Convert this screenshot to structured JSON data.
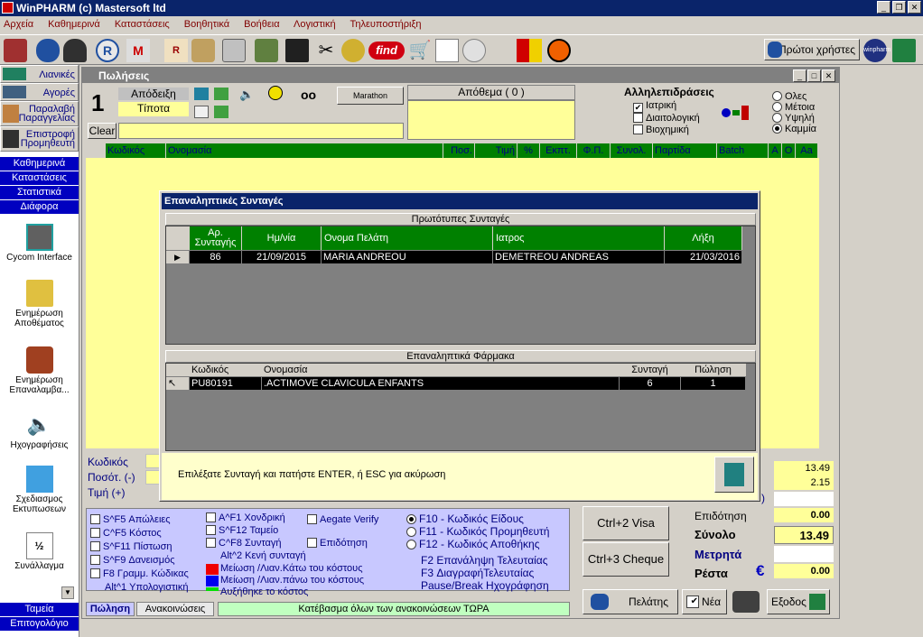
{
  "app": {
    "title": "WinPHARM (c) Mastersoft ltd"
  },
  "menu": [
    "Αρχεία",
    "Καθημερινά",
    "Καταστάσεις",
    "Βοηθητικά",
    "Βοήθεια",
    "Λογιστική",
    "Τηλευποστήριξη"
  ],
  "toolbar": {
    "find_label": "find",
    "first_users": "Πρώτοι χρήστες",
    "winpharm_badge": "winpharm"
  },
  "sidebar": {
    "buttons": [
      "Λιανικές",
      "Αγορές",
      "Παραλαβή Παραγγελίας",
      "Επιστροφή Προμηθευτή"
    ],
    "sections": [
      "Καθημερινά",
      "Καταστάσεις",
      "Στατιστικά",
      "Διάφορα"
    ],
    "icons": [
      "Cycom Interface",
      "Ενημέρωση Αποθέματος",
      "Ενημέρωση Επαναλαμβα...",
      "Ηχογραφήσεις",
      "Σχεδιασμος Εκτυπωσεων",
      "Συνάλλαγμα"
    ],
    "bottom": [
      "Ταμεία",
      "Επιτογολόγιο"
    ]
  },
  "sales": {
    "title": "Πωλήσεις",
    "number": "1",
    "receipt": "Απόδειξη",
    "nothing": "Τίποτα",
    "marathon": "Marathon",
    "stock": "Απόθεμα ( 0 )",
    "clear": "Clear",
    "interactions_title": "Αλληλεπιδράσεις",
    "interactions": [
      {
        "label": "Ιατρική",
        "checked": true
      },
      {
        "label": "Διαιτολογική",
        "checked": false
      },
      {
        "label": "Βιοχημική",
        "checked": false
      }
    ],
    "levels": [
      {
        "label": "Ολες",
        "on": false
      },
      {
        "label": "Μέτοια",
        "on": false
      },
      {
        "label": "Υψηλή",
        "on": false
      },
      {
        "label": "Καμμία",
        "on": true
      }
    ],
    "columns": [
      "Κωδικός",
      "Ονομασία",
      "Ποσ.",
      "Τιμή",
      "%",
      "Εκπτ.",
      "Φ.Π.",
      "Συνολ.",
      "Παρτίδα",
      "Batch",
      "A",
      "O",
      "Aa"
    ]
  },
  "dialog": {
    "title": "Επαναληπτικές Συνταγές",
    "orig_header": "Πρωτότυπες Συνταγές",
    "orig_columns": [
      "Αρ. Συνταγής",
      "Ημ/νία",
      "Ονομα Πελάτη",
      "Ιατρος",
      "Λήξη"
    ],
    "orig_row": [
      "86",
      "21/09/2015",
      "MARIA ANDREOU",
      "DEMETREOU ANDREAS",
      "21/03/2016"
    ],
    "drugs_header": "Επαναληπτικά Φάρμακα",
    "drug_columns": [
      "Κωδικός",
      "Ονομασία",
      "Συνταγή",
      "Πώληση"
    ],
    "drug_row": [
      "PU80191",
      ".ACTIMOVE CLAVICULA ENFANTS",
      "6",
      "1"
    ],
    "hint": "Επιλέξατε Συνταγή και πατήστε ENTER, ή ESC για ακύρωση"
  },
  "entry": {
    "code": "Κωδικός",
    "qty": "Ποσότ. (-)",
    "price": "Τιμή (+)"
  },
  "totals": {
    "v1": "13.49",
    "v2": "2.15",
    "paren": ")",
    "discount_label": "Επιδότηση",
    "discount": "0.00",
    "total_label": "Σύνολο",
    "total": "13.49",
    "cash_label": "Μετρητά",
    "change_label": "Ρέστα",
    "currency": "€",
    "change": "0.00"
  },
  "shortcuts": {
    "col1": [
      "S^F5 Απώλειες",
      "C^F5 Κόστος",
      "S^F11 Πίστωση",
      "S^F9 Δανεισμός",
      "F8 Γραμμ. Κώδικας",
      "Alt^1 Υπολογιστική"
    ],
    "col2": [
      "A^F1 Χονδρική",
      "S^F12 Ταμείο",
      "C^F8 Συνταγή",
      "Alt^2 Κενή συνταγή"
    ],
    "col3": [
      "Aegate Verify",
      "Επιδότηση"
    ],
    "colors": [
      "Μείωση /Λιαν.Κάτω του κόστους",
      "Μείωση /Λιαν.πάνω του κόστους",
      "Αυξήθηκε το κόστος"
    ],
    "radios": [
      "F10 - Κωδικός Είδους",
      "F11 - Κωδικός Προμηθευτή",
      "F12 - Κωδικός Αποθήκης"
    ],
    "extra": [
      "F2 Επανάληψη Τελευταίας",
      "F3 ΔιαγραφήΤελευταίας",
      "Pause/Break Ηχογράφηση"
    ]
  },
  "buttons": {
    "visa": "Ctrl+2  Visa",
    "cheque": "Ctrl+3 Cheque",
    "customer": "Πελάτης",
    "new": "Νέα",
    "exit": "Εξοδος"
  },
  "tabs": [
    "Πώληση",
    "Ανακοινώσεις"
  ],
  "download": "Κατέβασμα όλων των ανακοινώσεων ΤΩΡΑ"
}
